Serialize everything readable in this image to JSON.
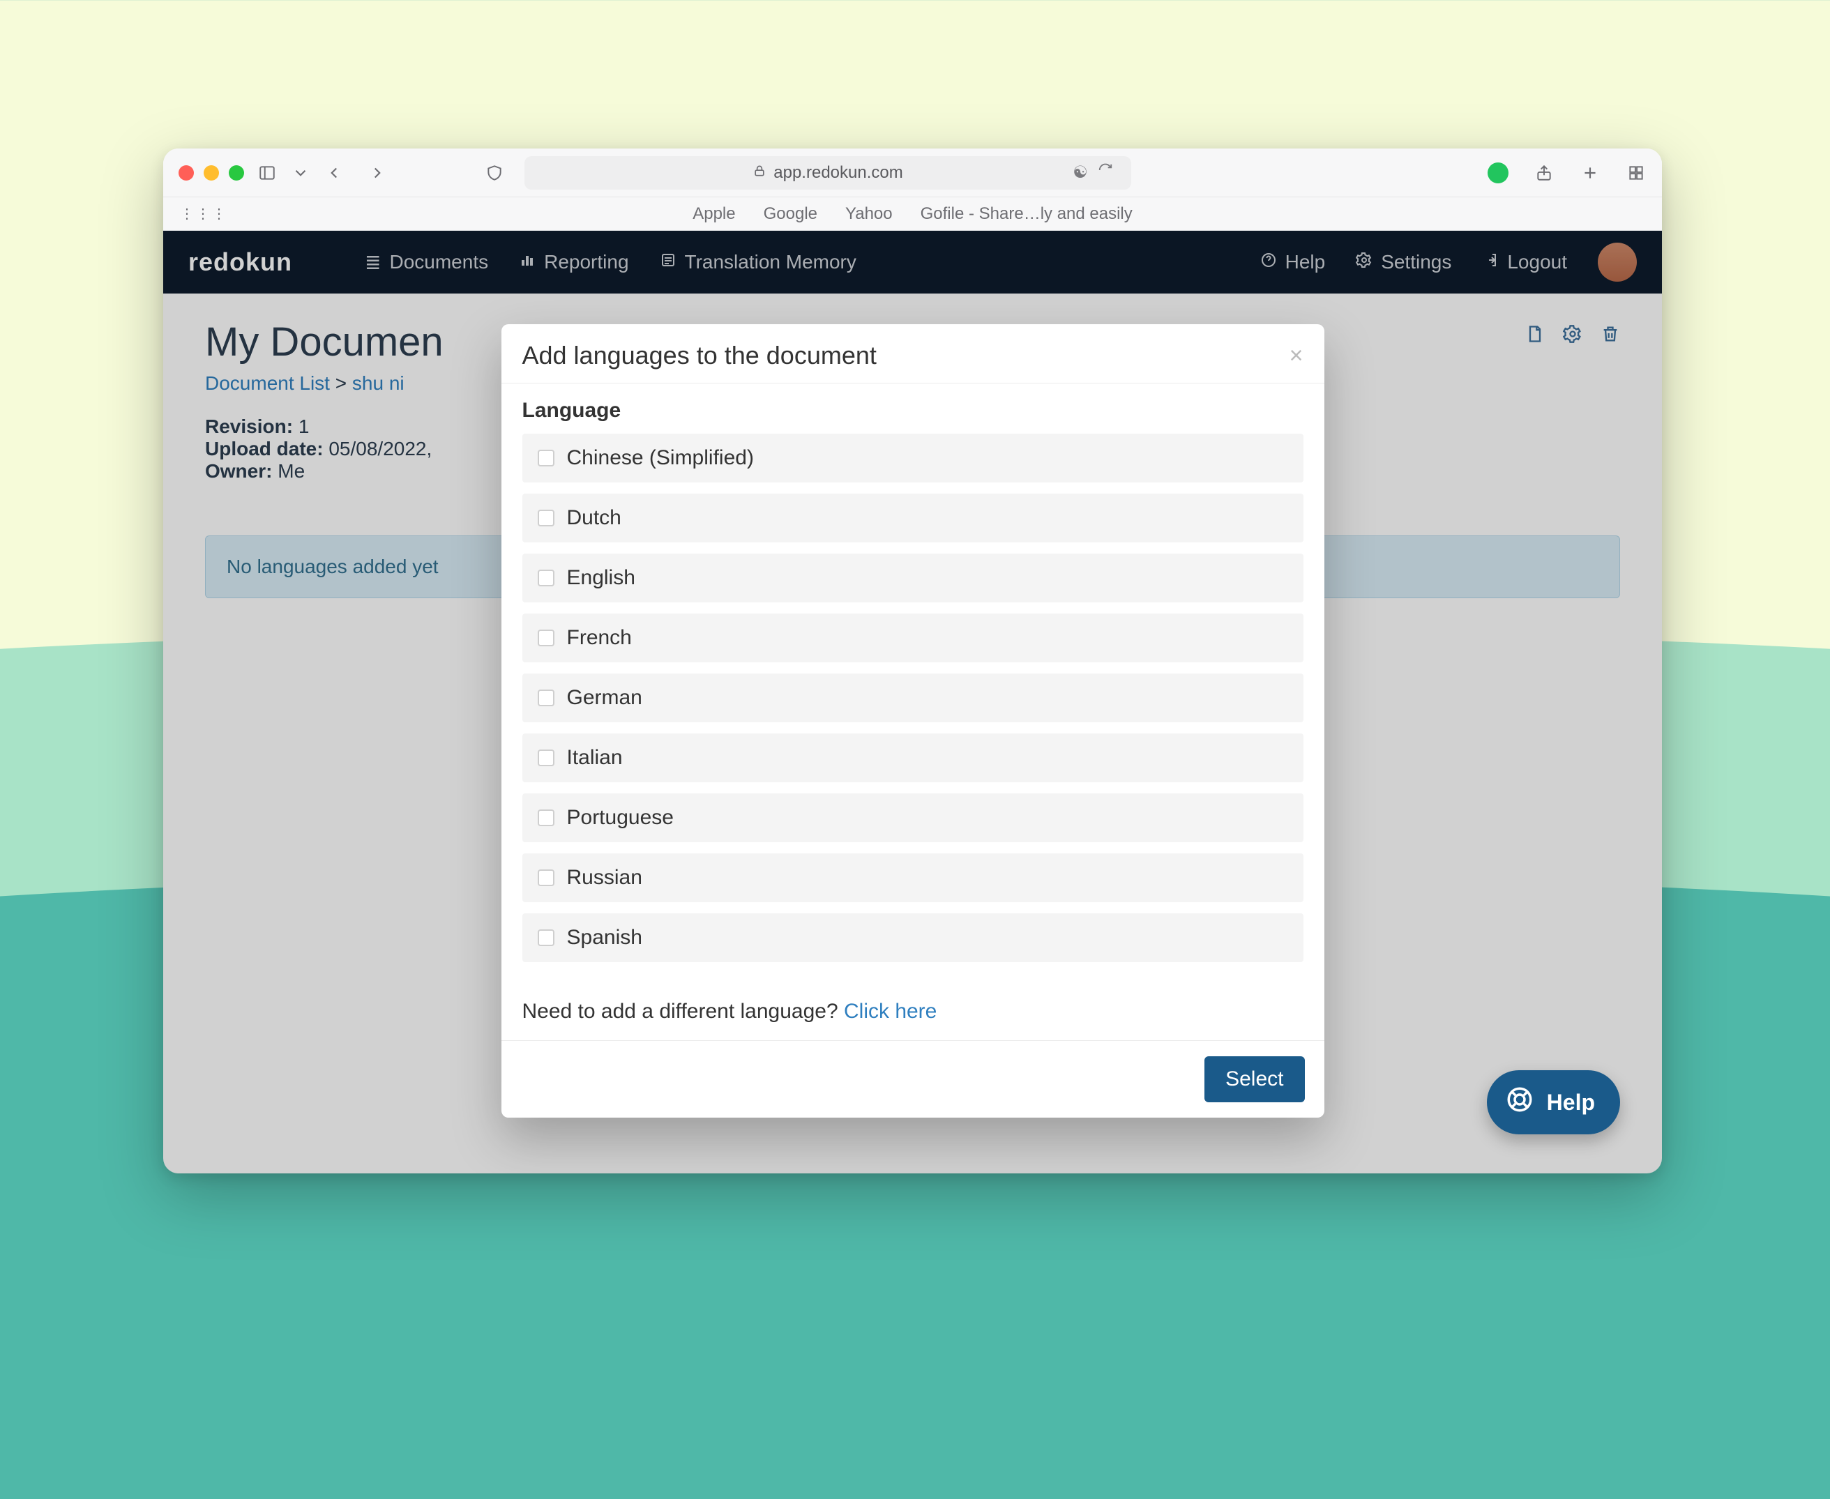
{
  "browser": {
    "url_host": "app.redokun.com",
    "bookmarks": [
      "Apple",
      "Google",
      "Yahoo",
      "Gofile - Share…ly and easily"
    ]
  },
  "appnav": {
    "brand": "redokun",
    "links": {
      "documents": "Documents",
      "reporting": "Reporting",
      "tm": "Translation Memory",
      "help": "Help",
      "settings": "Settings",
      "logout": "Logout"
    }
  },
  "page": {
    "title": "My Documen",
    "breadcrumb": {
      "list": "Document List",
      "sep": ">",
      "current": "shu ni"
    },
    "meta": {
      "revision_label": "Revision:",
      "revision": "1",
      "upload_label": "Upload date:",
      "upload": "05/08/2022,",
      "owner_label": "Owner:",
      "owner": "Me"
    },
    "banner": "No languages added yet"
  },
  "modal": {
    "title": "Add languages to the document",
    "label": "Language",
    "languages": [
      "Chinese (Simplified)",
      "Dutch",
      "English",
      "French",
      "German",
      "Italian",
      "Portuguese",
      "Russian",
      "Spanish"
    ],
    "note_prefix": "Need to add a different language? ",
    "note_link": "Click here",
    "select": "Select"
  },
  "help": {
    "label": "Help"
  }
}
